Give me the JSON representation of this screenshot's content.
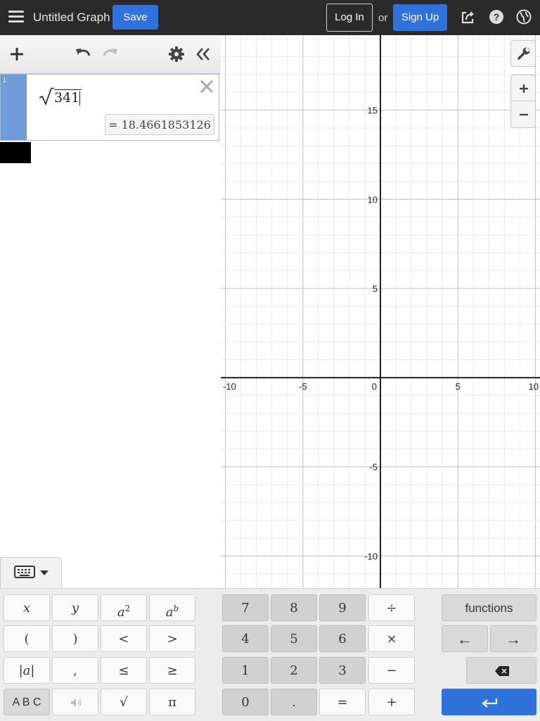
{
  "topbar": {
    "title": "Untitled Graph",
    "save_label": "Save",
    "login_label": "Log In",
    "or_text": "or",
    "signup_label": "Sign Up",
    "icons": [
      "hamburger-menu-icon",
      "share-icon",
      "help-icon",
      "globe-icon"
    ],
    "accent_color": "#2f72dc",
    "bar_color": "#2a2a2a"
  },
  "expression_list": {
    "toolbar_icons": [
      "add-icon",
      "undo-icon",
      "redo-icon",
      "gear-icon",
      "collapse-icon"
    ],
    "expressions": [
      {
        "index": "1",
        "radicand": "341",
        "result": "= 18.4661853126",
        "tab_color": "#6f9bd9"
      }
    ]
  },
  "graph": {
    "x_ticks": [
      "-10",
      "-5",
      "0",
      "5",
      "10"
    ],
    "y_ticks": [
      "15",
      "10",
      "5",
      "-5",
      "-10"
    ],
    "x_range": [
      -10.3,
      10.3
    ],
    "y_range": [
      -11.8,
      19.2
    ],
    "controls": [
      "wrench-icon",
      "zoom-in-icon",
      "zoom-out-icon"
    ]
  },
  "keypad": {
    "toggle_icons": [
      "keyboard-icon",
      "caret-down-icon"
    ],
    "row1": [
      "x",
      "y",
      "a2",
      "ab",
      "7",
      "8",
      "9",
      "÷",
      "functions"
    ],
    "row2": [
      "(",
      ")",
      "<",
      ">",
      "4",
      "5",
      "6",
      "×",
      "←",
      "→"
    ],
    "row3": [
      "|a|",
      ",",
      "≤",
      "≥",
      "1",
      "2",
      "3",
      "−",
      "⌫"
    ],
    "row4": [
      "A B C",
      "🔊",
      "√",
      "π",
      "0",
      ".",
      "=",
      "+",
      "↵"
    ]
  }
}
